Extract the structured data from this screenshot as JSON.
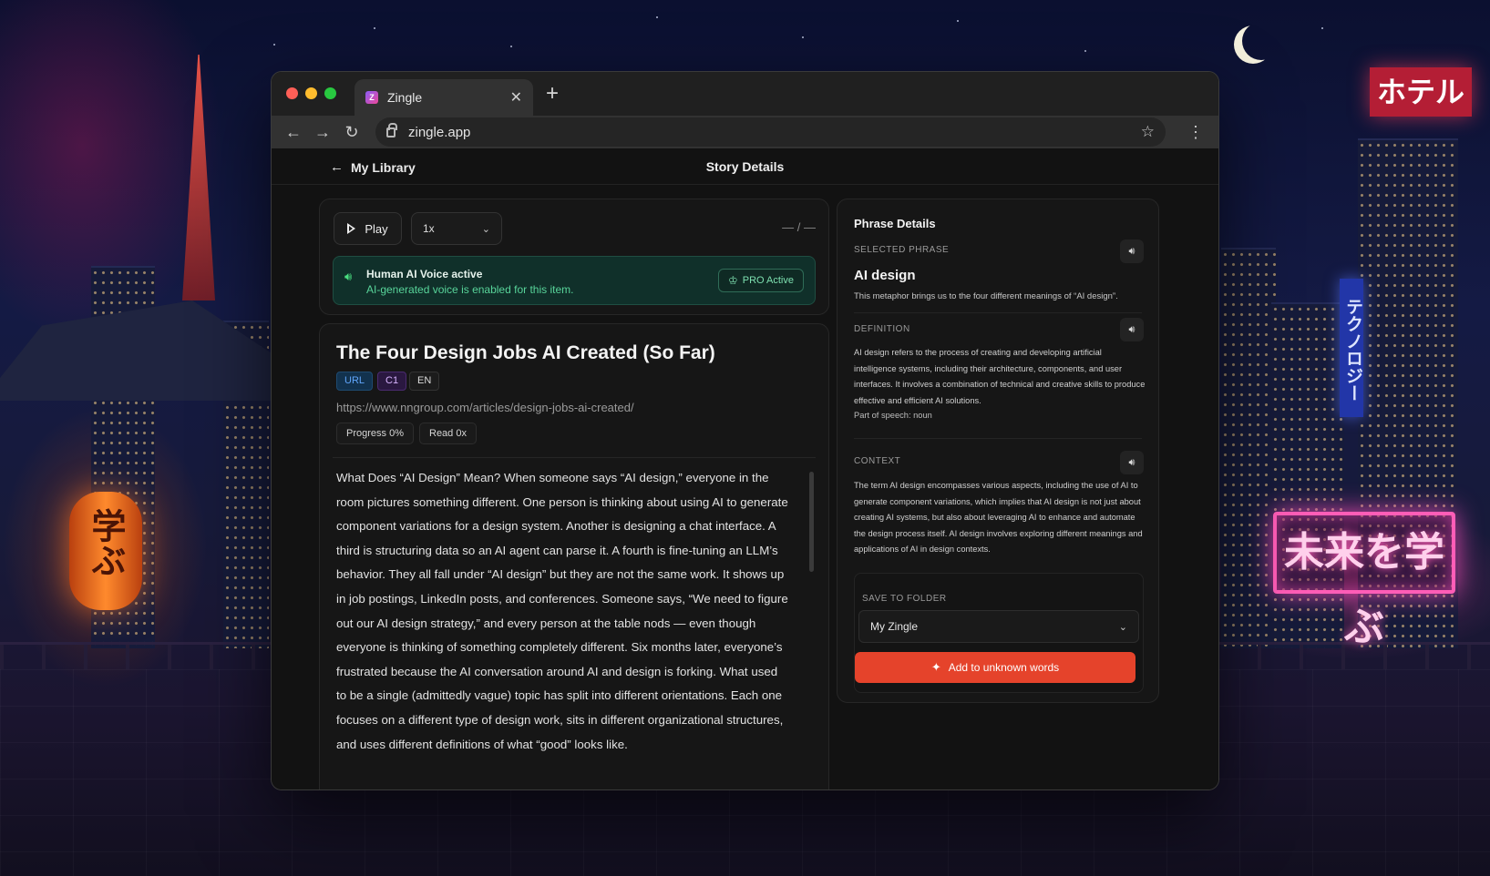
{
  "browser": {
    "tab_title": "Zingle",
    "tab_favicon": "Z",
    "url": "zingle.app"
  },
  "header": {
    "back_label": "My Library",
    "title": "Story Details"
  },
  "player": {
    "play_label": "Play",
    "speed": "1x",
    "time": "— / —",
    "voice_title": "Human AI Voice active",
    "voice_subtitle": "AI-generated voice is enabled for this item.",
    "pro_label": "PRO Active"
  },
  "story": {
    "title": "The Four Design Jobs AI Created (So Far)",
    "tags": [
      "URL",
      "C1",
      "EN"
    ],
    "source_url": "https://www.nngroup.com/articles/design-jobs-ai-created/",
    "progress": "Progress 0%",
    "reads": "Read 0x",
    "body": "What Does “AI Design” Mean? When someone says “AI design,” everyone in the room pictures something different. One person is thinking about using AI to generate component variations for a design system. Another is designing a chat interface. A third is structuring data so an AI agent can parse it. A fourth is fine-tuning an LLM’s behavior. They all fall under “AI design” but they are not the same work. It shows up in job postings, LinkedIn posts, and conferences. Someone says, “We need to figure out our AI design strategy,” and every person at the table nods — even though everyone is thinking of something completely different. Six months later, everyone’s frustrated because the AI conversation around AI and design is forking. What used to be a single (admittedly vague) topic has split into different orientations. Each one focuses on a different type of design work, sits in different organizational structures, and uses different definitions of what “good” looks like."
  },
  "details": {
    "title": "Phrase Details",
    "selected_label": "SELECTED PHRASE",
    "phrase": "AI design",
    "phrase_example": "This metaphor brings us to the four different meanings of “AI design”.",
    "definition_label": "DEFINITION",
    "definition": "AI design refers to the process of creating and developing artificial intelligence systems, including their architecture, components, and user interfaces. It involves a combination of technical and creative skills to produce effective and efficient AI solutions.",
    "part_of_speech": "Part of speech: noun",
    "context_label": "CONTEXT",
    "context": "The term AI design encompasses various aspects, including the use of AI to generate component variations, which implies that AI design is not just about creating AI systems, but also about leveraging AI to enhance and automate the design process itself. AI design involves exploring different meanings and applications of AI in design contexts.",
    "folder_label": "SAVE TO FOLDER",
    "folder_value": "My Zingle",
    "add_label": "Add to unknown words"
  },
  "scene": {
    "sign_hotel": "ホテル",
    "sign_tech": "テクノロジー",
    "sign_neon": "未来を学ぶ",
    "lantern": "学ぶ"
  },
  "colors": {
    "accent": "#e5432b",
    "voice_green": "#4ade80",
    "tag_url": "#60a5fa",
    "tag_c1": "#d8b4fe"
  }
}
